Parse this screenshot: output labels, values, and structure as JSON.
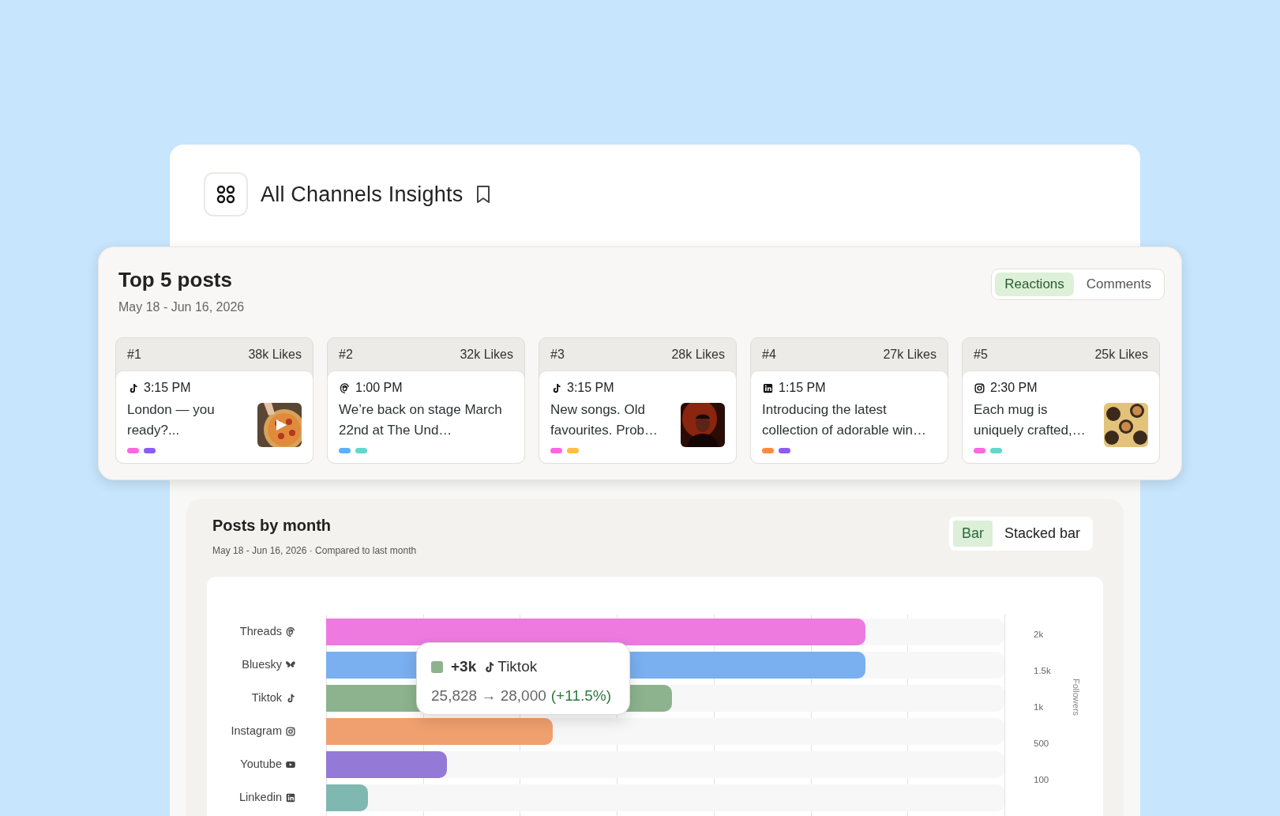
{
  "header": {
    "title": "All Channels Insights",
    "bookmarked": false
  },
  "top_posts": {
    "title": "Top 5 posts",
    "date_range": "May 18 - Jun 16, 2026",
    "toggle": [
      {
        "label": "Reactions",
        "selected": true
      },
      {
        "label": "Comments",
        "selected": false
      }
    ],
    "posts": [
      {
        "rank": "#1",
        "likes": "38k Likes",
        "kind": "tiktok",
        "time": "3:15 PM",
        "text": "London — you ready?...",
        "thumbnail": {
          "kind": "picture",
          "video": true
        },
        "tags": [
          {
            "color": "#ff66e0"
          },
          {
            "color": "#8b5cf6"
          }
        ]
      },
      {
        "rank": "#2",
        "likes": "32k Likes",
        "kind": "threads",
        "time": "1:00 PM",
        "text": "We’re back on stage March 22nd at The Und…",
        "tags": [
          {
            "color": "#5bb0ff"
          },
          {
            "color": "#5fd9cc"
          }
        ]
      },
      {
        "rank": "#3",
        "likes": "28k Likes",
        "kind": "tiktok",
        "time": "3:15 PM",
        "text": "New songs. Old favourites. Prob…",
        "thumbnail": {
          "kind": "picture",
          "video": false
        },
        "tags": [
          {
            "color": "#ff66e0"
          },
          {
            "color": "#ffbf3f"
          }
        ]
      },
      {
        "rank": "#4",
        "likes": "27k Likes",
        "kind": "linkedin",
        "time": "1:15 PM",
        "text": "Introducing the latest collection of adorable win…",
        "tags": [
          {
            "color": "#ff8a3d"
          },
          {
            "color": "#8b5cf6"
          }
        ]
      },
      {
        "rank": "#5",
        "likes": "25k Likes",
        "kind": "instagram",
        "time": "2:30 PM",
        "text": "Each mug is uniquely crafted,…",
        "thumbnail": {
          "kind": "picture",
          "video": false
        },
        "tags": [
          {
            "color": "#ff66e0"
          },
          {
            "color": "#5fd9cc"
          }
        ]
      }
    ]
  },
  "posts_by_month": {
    "title": "Posts by month",
    "subtitle": "May 18 - Jun 16, 2026 · Compared to last month",
    "toggle": [
      {
        "label": "Bar",
        "selected": true
      },
      {
        "label": "Stacked bar",
        "selected": false
      }
    ],
    "bars": [
      {
        "label": "Threads",
        "kind": "threads",
        "color": "#ee7ae0",
        "level": 0.795
      },
      {
        "label": "Bluesky",
        "kind": "bluesky",
        "color": "#7aaff0",
        "level": 0.795
      },
      {
        "label": "Tiktok",
        "kind": "tiktok",
        "color": "#8db38e",
        "level": 0.51
      },
      {
        "label": "Instagram",
        "kind": "instagram",
        "color": "#f0a06e",
        "level": 0.334
      },
      {
        "label": "Youtube",
        "kind": "youtube",
        "color": "#9579d6",
        "level": 0.178
      },
      {
        "label": "Linkedin",
        "kind": "linkedin",
        "color": "#7fb8b0",
        "level": 0.062
      }
    ],
    "axis_ticks": [
      "2k",
      "1.5k",
      "1k",
      "500",
      "100"
    ],
    "axis_label": "Followers",
    "tooltip": {
      "color": "#8db38e",
      "change": "+3k",
      "kind": "tiktok",
      "channel": "Tiktok",
      "values": "25,828 → 28,000",
      "percent": "(+11.5%)"
    }
  }
}
